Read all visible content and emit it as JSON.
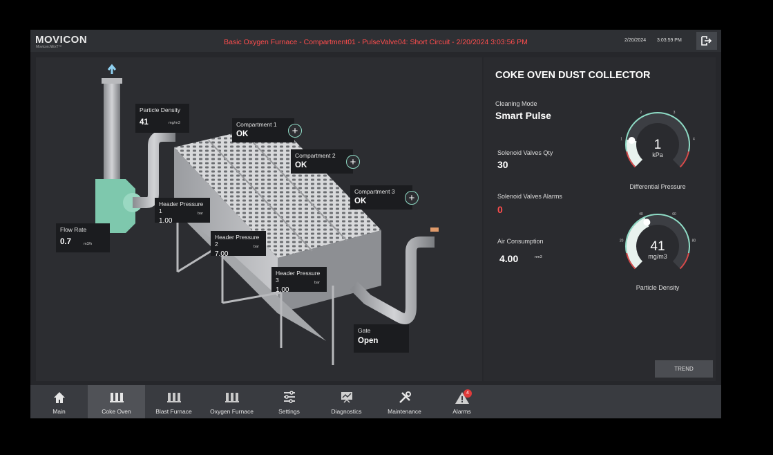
{
  "header": {
    "logo": "MOVICON",
    "logo_sub": "Movicon.NExT™",
    "alarm_message": "Basic Oxygen Furnace - Compartment01 - PulseValve04: Short Circuit - 2/20/2024 3:03:56 PM",
    "date": "2/20/2024",
    "time": "3:03:59 PM",
    "logout_icon": "logout-icon"
  },
  "plant": {
    "particle_density": {
      "label": "Particle Density",
      "value": "41",
      "unit": "mg/m3"
    },
    "flow_rate": {
      "label": "Flow Rate",
      "value": "0.7",
      "unit": "m3/h"
    },
    "header_pressure_1": {
      "label": "Header Pressure 1",
      "value": "1.00",
      "unit": "bar"
    },
    "header_pressure_2": {
      "label": "Header Pressure 2",
      "value": "7.00",
      "unit": "bar"
    },
    "header_pressure_3": {
      "label": "Header Pressure 3",
      "value": "1.00",
      "unit": "bar"
    },
    "compartment_1": {
      "label": "Compartment 1",
      "value": "OK"
    },
    "compartment_2": {
      "label": "Compartment 2",
      "value": "OK"
    },
    "compartment_3": {
      "label": "Compartment 3",
      "value": "OK"
    },
    "gate": {
      "label": "Gate",
      "value": "Open"
    },
    "plus": "+"
  },
  "side": {
    "title": "COKE OVEN DUST COLLECTOR",
    "cleaning_mode": {
      "label": "Cleaning Mode",
      "value": "Smart Pulse"
    },
    "solenoid_qty": {
      "label": "Solenoid Valves Qty",
      "value": "30"
    },
    "solenoid_alarms": {
      "label": "Solenoid Valves Alarms",
      "value": "0"
    },
    "air_consumption": {
      "label": "Air Consumption",
      "value": "4.00",
      "unit": "nm3"
    },
    "diff_pressure_gauge": {
      "caption": "Differential Pressure",
      "value": "1",
      "unit": "kPa",
      "min": 0,
      "max": 5,
      "ticks": [
        "1",
        "2",
        "3",
        "4"
      ],
      "reading": 1
    },
    "particle_gauge": {
      "caption": "Particle Density",
      "value": "41",
      "unit": "mg/m3",
      "min": 0,
      "max": 100,
      "ticks": [
        "20",
        "40",
        "60",
        "80"
      ],
      "reading": 41
    },
    "trend_label": "TREND"
  },
  "nav": {
    "items": [
      {
        "label": "Main",
        "icon": "home-icon"
      },
      {
        "label": "Coke Oven",
        "icon": "coke-oven-icon"
      },
      {
        "label": "Blast Furnace",
        "icon": "blast-furnace-icon"
      },
      {
        "label": "Oxygen Furnace",
        "icon": "oxygen-furnace-icon"
      },
      {
        "label": "Settings",
        "icon": "sliders-icon"
      },
      {
        "label": "Diagnostics",
        "icon": "diagnostics-icon"
      },
      {
        "label": "Maintenance",
        "icon": "tools-icon"
      },
      {
        "label": "Alarms",
        "icon": "alarm-icon"
      }
    ],
    "alarm_count": "4"
  },
  "colors": {
    "accent": "#8fdcc6",
    "alarm": "#ff4d4d",
    "gauge_red": "#d94a4a"
  }
}
